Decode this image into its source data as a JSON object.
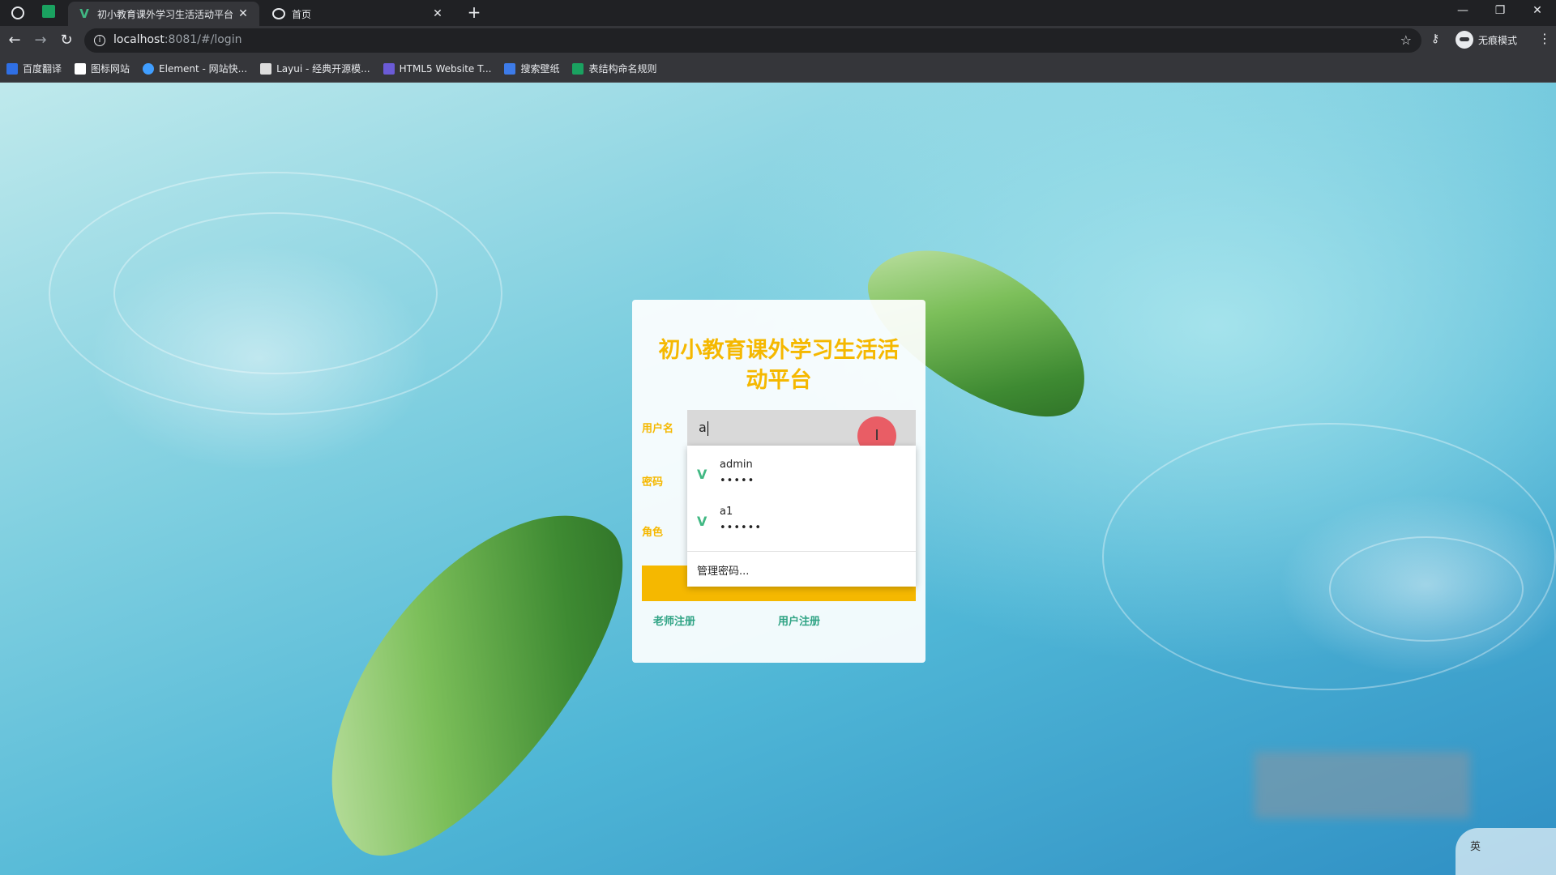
{
  "browser": {
    "tabs": [
      {
        "label": "初小教育课外学习生活活动平台",
        "active": true,
        "icon": "vue-icon"
      },
      {
        "label": "首页",
        "active": false,
        "icon": "globe-icon"
      }
    ],
    "url_host": "localhost",
    "url_path": ":8081/#/login",
    "profile_label": "无痕模式",
    "bookmarks": [
      {
        "label": "百度翻译",
        "color": "#2f6fe4"
      },
      {
        "label": "图标网站",
        "color": "#ffffff"
      },
      {
        "label": "Element - 网站快...",
        "color": "#409eff"
      },
      {
        "label": "Layui - 经典开源模...",
        "color": "#dddddd"
      },
      {
        "label": "HTML5 Website T...",
        "color": "#6b5bd6"
      },
      {
        "label": "搜索壁纸",
        "color": "#3d7be8"
      },
      {
        "label": "表结构命名规则",
        "color": "#1aa260"
      }
    ]
  },
  "login": {
    "title": "初小教育课外学习生活活动平台",
    "username_label": "用户名",
    "password_label": "密码",
    "role_label": "角色",
    "username_value": "a",
    "teacher_register": "老师注册",
    "user_register": "用户注册",
    "accent_color": "#f5b800"
  },
  "autofill": {
    "items": [
      {
        "username": "admin",
        "password_mask": "•••••"
      },
      {
        "username": "a1",
        "password_mask": "••••••"
      }
    ],
    "manage_label": "管理密码..."
  },
  "ime": {
    "label": "英"
  }
}
